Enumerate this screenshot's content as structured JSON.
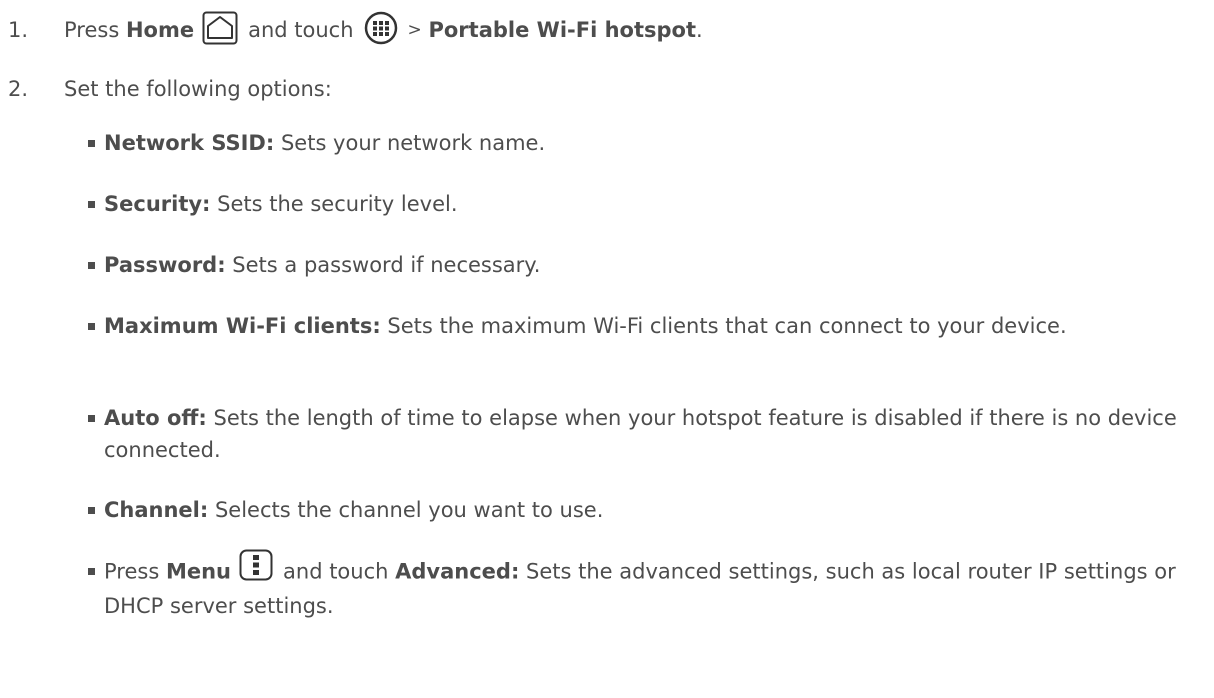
{
  "step1": {
    "number": "1.",
    "press": "Press",
    "home_label": "Home",
    "and_touch": "and touch",
    "separator": ">",
    "destination": "Portable Wi-Fi hotspot",
    "period": ".",
    "icons": [
      "home-icon",
      "apps-icon"
    ]
  },
  "step2": {
    "number": "2.",
    "text": "Set the following options:"
  },
  "options": [
    {
      "label": "Network SSID:",
      "text": " Sets your network name."
    },
    {
      "label": "Security:",
      "text": " Sets the security level."
    },
    {
      "label": "Password:",
      "text": " Sets a password if necessary."
    },
    {
      "label": "Maximum Wi-Fi clients:",
      "text": " Sets the maximum Wi-Fi clients that can connect to your device."
    },
    {
      "label": "Auto off:",
      "text": " Sets the length of time to elapse when your hotspot feature is disabled if there is no device connected."
    },
    {
      "label": "Channel:",
      "text": " Selects the channel you want to use."
    }
  ],
  "menu_option": {
    "press": "Press",
    "menu_label": "Menu",
    "and_touch": "and touch",
    "advanced_label": "Advanced:",
    "text": " Sets the advanced settings, such as local router IP settings or DHCP server settings.",
    "icon": "menu-icon"
  },
  "colors": {
    "text": "#4d4d4d",
    "icon_stroke": "#333333"
  }
}
